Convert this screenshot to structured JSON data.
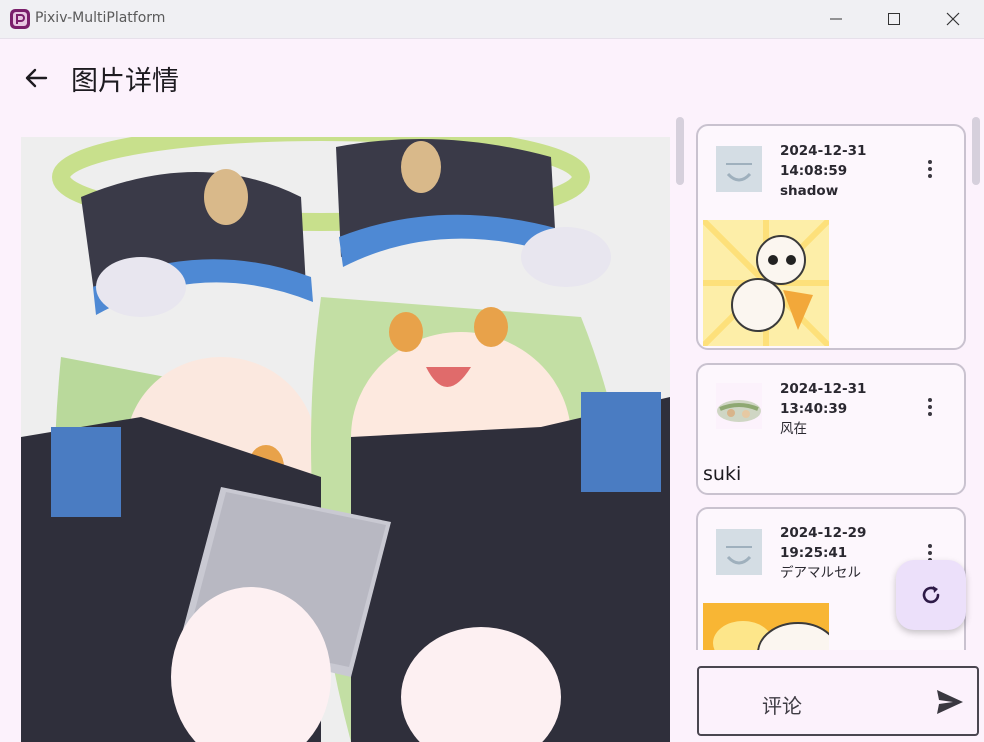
{
  "window": {
    "title": "Pixiv-MultiPlatform",
    "controls": [
      "minimize-icon",
      "maximize-icon",
      "close-icon"
    ]
  },
  "header": {
    "back_icon": "arrow-back-icon",
    "title": "图片详情"
  },
  "comments": [
    {
      "date": "2024-12-31",
      "time": "14:08:59",
      "author": "shadow",
      "content_type": "sticker",
      "text": ""
    },
    {
      "date": "2024-12-31",
      "time": "13:40:39",
      "author": "风在",
      "content_type": "text",
      "text": "suki"
    },
    {
      "date": "2024-12-29",
      "time": "19:25:41",
      "author": "デアマルセル",
      "content_type": "sticker",
      "text": ""
    }
  ],
  "fab": {
    "icon": "refresh-icon"
  },
  "comment_input": {
    "placeholder": "评论",
    "send_icon": "send-icon"
  },
  "colors": {
    "background": "#fcf2fc",
    "fab": "#ece0fa",
    "card_border": "#c9c2cf",
    "app_icon": "#7b1f6b"
  }
}
